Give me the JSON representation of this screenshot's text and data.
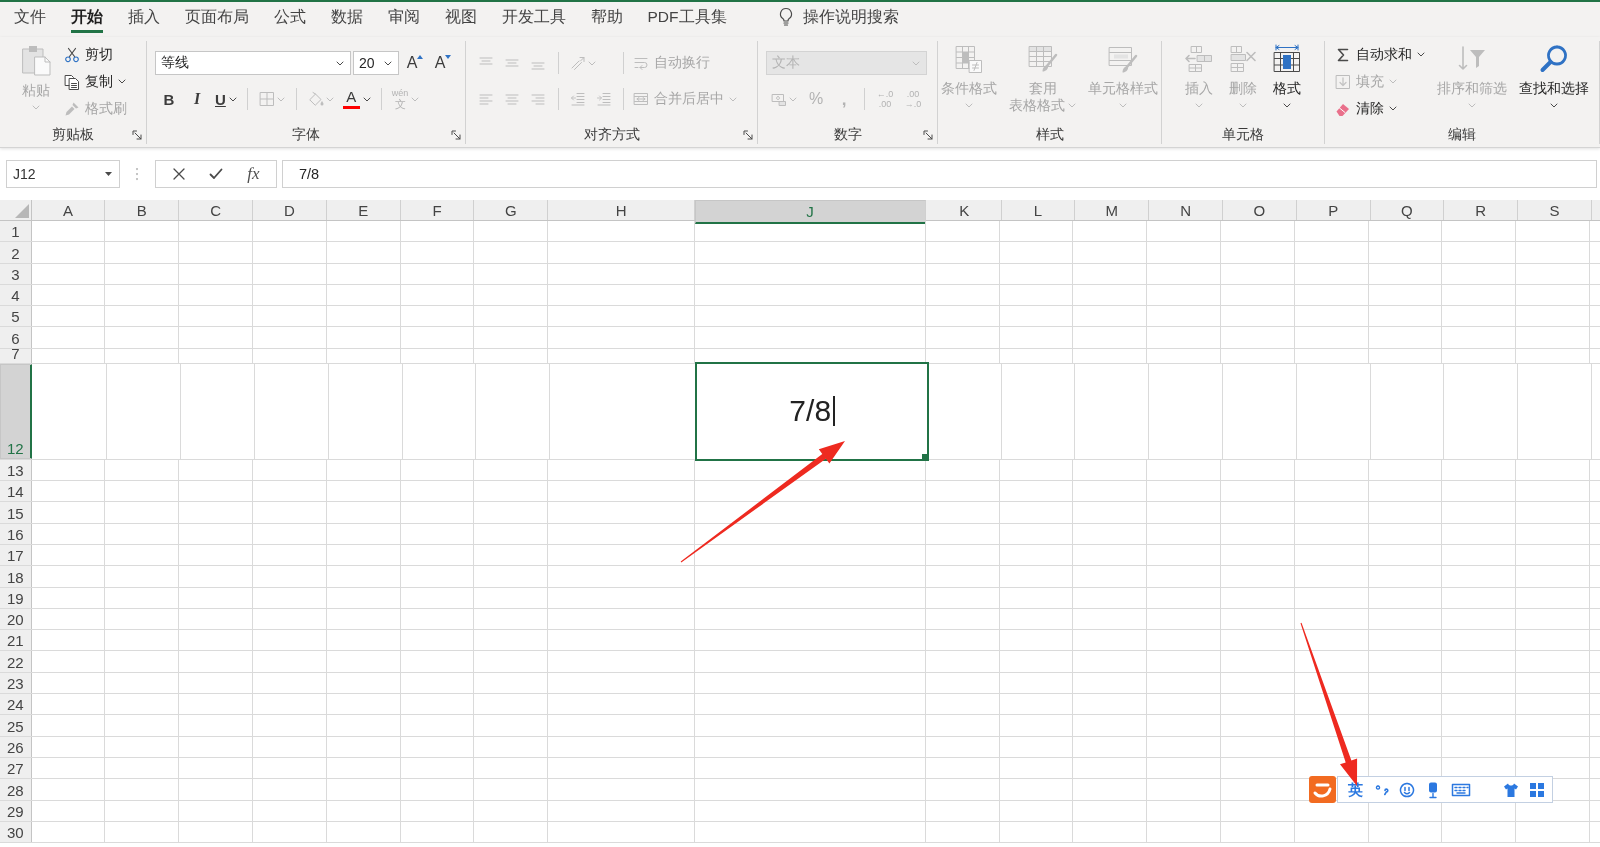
{
  "tabs": [
    {
      "label": "文件",
      "selected": false
    },
    {
      "label": "开始",
      "selected": true
    },
    {
      "label": "插入",
      "selected": false
    },
    {
      "label": "页面布局",
      "selected": false
    },
    {
      "label": "公式",
      "selected": false
    },
    {
      "label": "数据",
      "selected": false
    },
    {
      "label": "审阅",
      "selected": false
    },
    {
      "label": "视图",
      "selected": false
    },
    {
      "label": "开发工具",
      "selected": false
    },
    {
      "label": "帮助",
      "selected": false
    },
    {
      "label": "PDF工具集",
      "selected": false
    }
  ],
  "tell_me": {
    "label": "操作说明搜索"
  },
  "ribbon": {
    "groups": [
      {
        "label": "剪贴板",
        "launcher": true,
        "items": [
          {
            "kind": "large",
            "label": "粘贴",
            "disabled": true,
            "dropdown": true
          },
          {
            "kind": "small",
            "label": "剪切",
            "disabled": false,
            "dropdown": false
          },
          {
            "kind": "small",
            "label": "复制",
            "disabled": false,
            "dropdown": true
          },
          {
            "kind": "small",
            "label": "格式刷",
            "disabled": true,
            "dropdown": false
          }
        ]
      },
      {
        "label": "字体",
        "launcher": true,
        "rows": [
          [
            {
              "kind": "select",
              "value": "等线",
              "disabled": false,
              "dropdown": true
            },
            {
              "kind": "select",
              "value": "20",
              "disabled": false,
              "dropdown": true
            },
            {
              "kind": "glyph",
              "label": "A",
              "disabled": false,
              "dropdown": false
            },
            {
              "kind": "glyph",
              "label": "A",
              "disabled": false,
              "dropdown": false
            }
          ],
          [
            {
              "kind": "glyph",
              "label": "B",
              "disabled": false,
              "dropdown": false
            },
            {
              "kind": "glyph",
              "label": "I",
              "disabled": false,
              "dropdown": false
            },
            {
              "kind": "glyph",
              "label": "U",
              "disabled": false,
              "dropdown": true
            },
            {
              "kind": "icon",
              "disabled": true,
              "dropdown": true
            },
            {
              "kind": "icon",
              "disabled": true,
              "dropdown": true
            },
            {
              "kind": "glyph",
              "label": "A",
              "color": "#ff0000",
              "disabled": false,
              "dropdown": true
            },
            {
              "kind": "glyph",
              "label": "文",
              "ruby": "wén",
              "disabled": true,
              "dropdown": true
            }
          ]
        ]
      },
      {
        "label": "对齐方式",
        "launcher": true,
        "rows": [
          [
            {
              "kind": "icon",
              "disabled": true,
              "dropdown": false
            },
            {
              "kind": "icon",
              "disabled": true,
              "dropdown": false
            },
            {
              "kind": "icon",
              "disabled": true,
              "dropdown": false
            },
            {
              "kind": "icon",
              "disabled": true,
              "dropdown": true
            },
            {
              "kind": "small",
              "label": "自动换行",
              "disabled": true,
              "dropdown": false
            }
          ],
          [
            {
              "kind": "icon",
              "disabled": true,
              "dropdown": false
            },
            {
              "kind": "icon",
              "disabled": true,
              "dropdown": false
            },
            {
              "kind": "icon",
              "disabled": true,
              "dropdown": false
            },
            {
              "kind": "icon",
              "disabled": true,
              "dropdown": false
            },
            {
              "kind": "icon",
              "disabled": true,
              "dropdown": false
            },
            {
              "kind": "small",
              "label": "合并后居中",
              "disabled": true,
              "dropdown": true
            }
          ]
        ]
      },
      {
        "label": "数字",
        "launcher": true,
        "rows": [
          [
            {
              "kind": "select",
              "value": "文本",
              "disabled": true,
              "dropdown": true
            }
          ],
          [
            {
              "kind": "icon",
              "disabled": true,
              "dropdown": true
            },
            {
              "kind": "glyph",
              "label": "%",
              "disabled": true,
              "dropdown": false
            },
            {
              "kind": "glyph",
              "label": ",",
              "disabled": true,
              "dropdown": false
            },
            {
              "kind": "glyph",
              "lines": [
                "←.0",
                ".00"
              ],
              "disabled": true,
              "dropdown": false
            },
            {
              "kind": "glyph",
              "lines": [
                ".00",
                "→.0"
              ],
              "disabled": true,
              "dropdown": false
            }
          ]
        ]
      },
      {
        "label": "样式",
        "launcher": false,
        "items": [
          {
            "kind": "large",
            "label": "条件格式",
            "disabled": true,
            "dropdown": true
          },
          {
            "kind": "large",
            "lines": [
              "套用",
              "表格格式"
            ],
            "disabled": true,
            "dropdown": true
          },
          {
            "kind": "large",
            "label": "单元格样式",
            "disabled": true,
            "dropdown": true
          }
        ]
      },
      {
        "label": "单元格",
        "launcher": false,
        "items": [
          {
            "kind": "large",
            "label": "插入",
            "disabled": true,
            "dropdown": true
          },
          {
            "kind": "large",
            "label": "删除",
            "disabled": true,
            "dropdown": true
          },
          {
            "kind": "large",
            "label": "格式",
            "disabled": false,
            "dropdown": true
          }
        ]
      },
      {
        "label": "编辑",
        "launcher": false,
        "items": [
          {
            "kind": "small",
            "label": "自动求和",
            "disabled": false,
            "dropdown": true
          },
          {
            "kind": "small",
            "label": "填充",
            "disabled": true,
            "dropdown": true
          },
          {
            "kind": "small",
            "label": "清除",
            "disabled": false,
            "dropdown": true
          },
          {
            "kind": "large",
            "label": "排序和筛选",
            "disabled": true,
            "dropdown": true
          },
          {
            "kind": "large",
            "label": "查找和选择",
            "disabled": false,
            "dropdown": true
          }
        ]
      }
    ]
  },
  "formula_bar": {
    "name_box": "J12",
    "function_button": "fx",
    "formula": "7/8"
  },
  "sheet": {
    "columns": [
      {
        "label": "A",
        "selected": false
      },
      {
        "label": "B",
        "selected": false
      },
      {
        "label": "C",
        "selected": false
      },
      {
        "label": "D",
        "selected": false
      },
      {
        "label": "E",
        "selected": false
      },
      {
        "label": "F",
        "selected": false
      },
      {
        "label": "G",
        "selected": false
      },
      {
        "label": "H",
        "selected": false
      },
      {
        "label": "J",
        "selected": true
      },
      {
        "label": "K",
        "selected": false
      },
      {
        "label": "L",
        "selected": false
      },
      {
        "label": "M",
        "selected": false
      },
      {
        "label": "N",
        "selected": false
      },
      {
        "label": "O",
        "selected": false
      },
      {
        "label": "P",
        "selected": false
      },
      {
        "label": "Q",
        "selected": false
      },
      {
        "label": "R",
        "selected": false
      },
      {
        "label": "S",
        "selected": false
      }
    ],
    "rows": [
      {
        "label": "1",
        "selected": false
      },
      {
        "label": "2",
        "selected": false
      },
      {
        "label": "3",
        "selected": false
      },
      {
        "label": "4",
        "selected": false
      },
      {
        "label": "5",
        "selected": false
      },
      {
        "label": "6",
        "selected": false
      },
      {
        "label": "7",
        "selected": false
      },
      {
        "label": "12",
        "selected": true
      },
      {
        "label": "13",
        "selected": false
      },
      {
        "label": "14",
        "selected": false
      },
      {
        "label": "15",
        "selected": false
      },
      {
        "label": "16",
        "selected": false
      },
      {
        "label": "17",
        "selected": false
      },
      {
        "label": "18",
        "selected": false
      },
      {
        "label": "19",
        "selected": false
      },
      {
        "label": "20",
        "selected": false
      },
      {
        "label": "21",
        "selected": false
      },
      {
        "label": "22",
        "selected": false
      },
      {
        "label": "23",
        "selected": false
      },
      {
        "label": "24",
        "selected": false
      },
      {
        "label": "25",
        "selected": false
      },
      {
        "label": "26",
        "selected": false
      },
      {
        "label": "27",
        "selected": false
      },
      {
        "label": "28",
        "selected": false
      },
      {
        "label": "29",
        "selected": false
      },
      {
        "label": "30",
        "selected": false
      }
    ],
    "active_cell": {
      "value": "7/8",
      "editing": true
    }
  },
  "ime_toolbar": {
    "mode": "英"
  }
}
